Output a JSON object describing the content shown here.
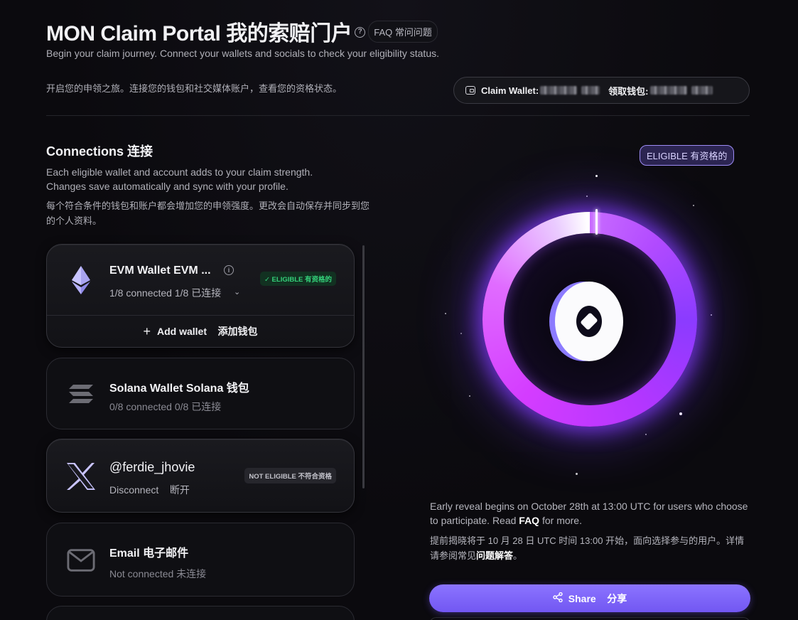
{
  "header": {
    "title": "MON Claim Portal  我的索赔门户",
    "faq_label": "FAQ  常问问题",
    "subtitle": "Begin your claim journey. Connect your wallets and socials to check your eligibility status.",
    "subtitle_cn": "开启您的申领之旅。连接您的钱包和社交媒体账户，查看您的资格状态。",
    "claim_wallet_label": "Claim Wallet:",
    "claim_wallet_label_cn": "领取钱包:"
  },
  "connections": {
    "title": "Connections  连接",
    "description": "Each eligible wallet and account adds to your claim strength. Changes save automatically and sync with your profile.",
    "description_cn": "每个符合条件的钱包和账户都会增加您的申领强度。更改会自动保存并同步到您的个人资料。",
    "cards": [
      {
        "name": "EVM Wallet  EVM ...",
        "status": "1/8 connected  1/8 已连接",
        "badge": "✓ ELIGIBLE  有资格的",
        "action": "Add wallet    添加钱包"
      },
      {
        "name": "Solana Wallet  Solana 钱包",
        "status": "0/8 connected  0/8 已连接"
      },
      {
        "name": "@ferdie_jhovie",
        "status": "Disconnect    断开",
        "badge": "NOT ELIGIBLE  不符合资格"
      },
      {
        "name": "Email  电子邮件",
        "status": "Not connected  未连接"
      }
    ]
  },
  "status_panel": {
    "eligibility": "ELIGIBLE  有资格的",
    "reveal_pre": "Early reveal begins on October 28th at 13:00 UTC for users who choose to participate. Read ",
    "reveal_link": "FAQ",
    "reveal_post": " for more.",
    "reveal_cn_pre": "提前揭晓将于 10 月 28 日 UTC 时间 13:00 开始，面向选择参与的用户。详情请参阅常见",
    "reveal_cn_link": "问题解答",
    "reveal_cn_post": "。",
    "share_label": "Share    分享"
  },
  "colors": {
    "accent": "#7c5cff",
    "eligible_green": "#34d17a",
    "background": "#0b0a0e"
  },
  "icons": [
    "help-icon",
    "wallet-icon",
    "ethereum-icon",
    "info-icon",
    "chevron-down-icon",
    "check-icon",
    "plus-icon",
    "solana-icon",
    "x-logo-icon",
    "mail-icon",
    "monad-logo-icon",
    "share-icon"
  ]
}
